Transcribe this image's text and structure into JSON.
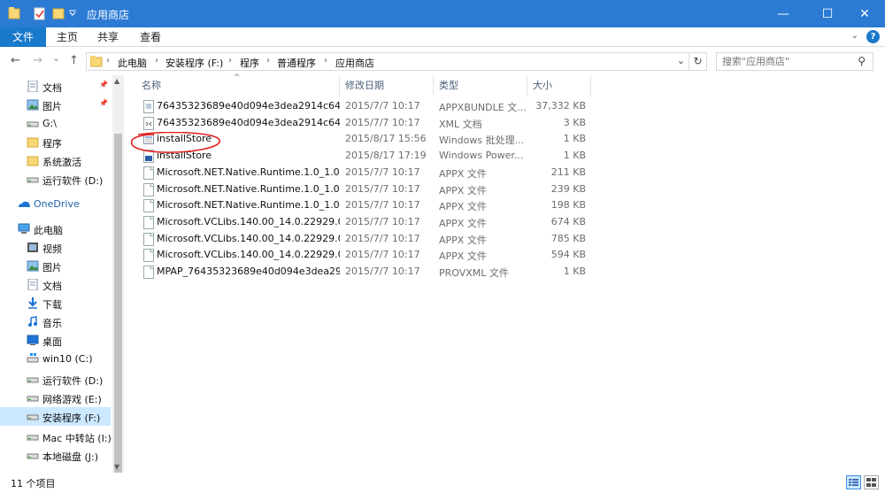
{
  "window": {
    "title": "应用商店",
    "controls": {
      "minimize": "—",
      "maximize": "☐",
      "close": "✕"
    }
  },
  "ribbon": {
    "tabs": [
      "文件",
      "主页",
      "共享",
      "查看"
    ],
    "help": "?"
  },
  "nav": {
    "back": "←",
    "forward": "→",
    "history": "⌄",
    "up": "↑",
    "breadcrumb": [
      "此电脑",
      "安装程序 (F:)",
      "程序",
      "普通程序",
      "应用商店"
    ],
    "search_placeholder": "搜索\"应用商店\""
  },
  "sidebar": {
    "items": [
      {
        "label": "文档",
        "icon": "documents-icon",
        "pinned": true
      },
      {
        "label": "图片",
        "icon": "pictures-icon",
        "pinned": true
      },
      {
        "label": "G:\\",
        "icon": "drive-icon"
      },
      {
        "label": "程序",
        "icon": "folder-icon"
      },
      {
        "label": "系统激活",
        "icon": "folder-icon"
      },
      {
        "label": "运行软件 (D:)",
        "icon": "drive-icon"
      },
      {
        "label": "OneDrive",
        "icon": "onedrive-icon"
      },
      {
        "label": "此电脑",
        "icon": "computer-icon"
      },
      {
        "label": "视频",
        "icon": "videos-icon"
      },
      {
        "label": "图片",
        "icon": "pictures-icon"
      },
      {
        "label": "文档",
        "icon": "documents-icon"
      },
      {
        "label": "下载",
        "icon": "downloads-icon"
      },
      {
        "label": "音乐",
        "icon": "music-icon"
      },
      {
        "label": "桌面",
        "icon": "desktop-icon"
      },
      {
        "label": "win10 (C:)",
        "icon": "windows-drive-icon"
      },
      {
        "label": "运行软件 (D:)",
        "icon": "drive-icon"
      },
      {
        "label": "网络游戏 (E:)",
        "icon": "drive-icon"
      },
      {
        "label": "安装程序 (F:)",
        "icon": "drive-icon",
        "selected": true
      },
      {
        "label": "Mac 中转站 (I:)",
        "icon": "drive-icon"
      },
      {
        "label": "本地磁盘 (J:)",
        "icon": "drive-icon"
      }
    ]
  },
  "columns": [
    "名称",
    "修改日期",
    "类型",
    "大小"
  ],
  "files": [
    {
      "name": "76435323689e40d094e3dea2914c64c...",
      "date": "2015/7/7 10:17",
      "type": "APPXBUNDLE 文...",
      "size": "37,332 KB",
      "icon": "appxbundle-file-icon"
    },
    {
      "name": "76435323689e40d094e3dea2914c64c...",
      "date": "2015/7/7 10:17",
      "type": "XML 文档",
      "size": "3 KB",
      "icon": "xml-file-icon"
    },
    {
      "name": "installStore",
      "date": "2015/8/17 15:56",
      "type": "Windows 批处理...",
      "size": "1 KB",
      "icon": "batch-file-icon",
      "circled": true
    },
    {
      "name": "installStore",
      "date": "2015/8/17 17:19",
      "type": "Windows Power...",
      "size": "1 KB",
      "icon": "powershell-file-icon"
    },
    {
      "name": "Microsoft.NET.Native.Runtime.1.0_1.0...",
      "date": "2015/7/7 10:17",
      "type": "APPX 文件",
      "size": "211 KB",
      "icon": "file-icon"
    },
    {
      "name": "Microsoft.NET.Native.Runtime.1.0_1.0...",
      "date": "2015/7/7 10:17",
      "type": "APPX 文件",
      "size": "239 KB",
      "icon": "file-icon"
    },
    {
      "name": "Microsoft.NET.Native.Runtime.1.0_1.0...",
      "date": "2015/7/7 10:17",
      "type": "APPX 文件",
      "size": "198 KB",
      "icon": "file-icon"
    },
    {
      "name": "Microsoft.VCLibs.140.00_14.0.22929.0...",
      "date": "2015/7/7 10:17",
      "type": "APPX 文件",
      "size": "674 KB",
      "icon": "file-icon"
    },
    {
      "name": "Microsoft.VCLibs.140.00_14.0.22929.0...",
      "date": "2015/7/7 10:17",
      "type": "APPX 文件",
      "size": "785 KB",
      "icon": "file-icon"
    },
    {
      "name": "Microsoft.VCLibs.140.00_14.0.22929.0...",
      "date": "2015/7/7 10:17",
      "type": "APPX 文件",
      "size": "594 KB",
      "icon": "file-icon"
    },
    {
      "name": "MPAP_76435323689e40d094e3dea29...",
      "date": "2015/7/7 10:17",
      "type": "PROVXML 文件",
      "size": "1 KB",
      "icon": "file-icon"
    }
  ],
  "status": {
    "item_count": "11 个项目"
  },
  "colors": {
    "titlebar": "#2b7bd4",
    "ribbon_file_tab": "#1979ca",
    "selection": "#cce8ff",
    "annotation": "#e02020"
  }
}
